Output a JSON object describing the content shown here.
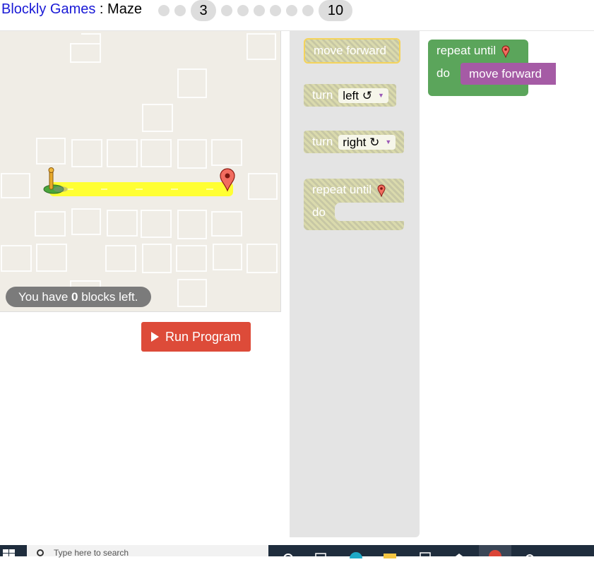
{
  "header": {
    "brand": "Blockly Games",
    "separator": " : ",
    "page_title": "Maze",
    "levels": [
      "1",
      "2",
      "3",
      "4",
      "5",
      "6",
      "7",
      "8",
      "9",
      "10"
    ],
    "current_level": "3",
    "last_level": "10"
  },
  "maze": {
    "blocks_left_prefix": "You have ",
    "blocks_left_count": "0",
    "blocks_left_suffix": " blocks left.",
    "run_label": "Run Program"
  },
  "toolbox": {
    "move_forward": "move forward",
    "turn_word": "turn",
    "left_option": "left ↺",
    "right_option": "right ↻",
    "repeat_until": "repeat until",
    "do_label": "do"
  },
  "workspace": {
    "repeat_until": "repeat until",
    "do_label": "do",
    "move_forward": "move forward"
  },
  "taskbar": {
    "search_placeholder": "Type here to search"
  },
  "colors": {
    "link": "#1a1ad6",
    "run_button": "#dd4b39",
    "loop_block": "#5ba55b",
    "movement_block": "#a55ba5",
    "path": "#ffff33",
    "marker": "#e74c3c"
  }
}
